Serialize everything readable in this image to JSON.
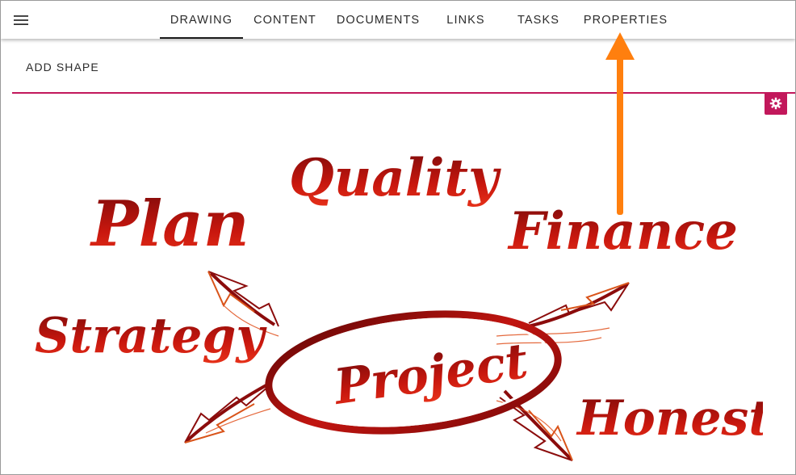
{
  "app": {
    "tabs": [
      {
        "label": "DRAWING",
        "active": true
      },
      {
        "label": "CONTENT",
        "active": false
      },
      {
        "label": "DOCUMENTS",
        "active": false
      },
      {
        "label": "LINKS",
        "active": false
      },
      {
        "label": "TASKS",
        "active": false
      },
      {
        "label": "PROPERTIES",
        "active": false
      }
    ],
    "accent_color": "#c2185b",
    "callout_color": "#ff7f0e"
  },
  "toolbar": {
    "add_shape_label": "ADD SHAPE",
    "settings_icon": "gear-icon",
    "menu_icon": "hamburger-menu-icon"
  },
  "drawing": {
    "words": {
      "plan": "Plan",
      "quality": "Quality",
      "finance": "Finance",
      "strategy": "Strategy",
      "project": "Project",
      "honesty": "Honesty"
    }
  }
}
